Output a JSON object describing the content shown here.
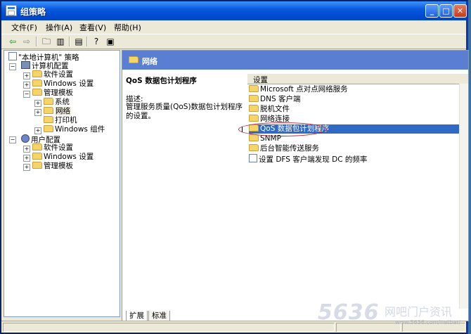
{
  "window": {
    "title": "组策略"
  },
  "menu": [
    "文件(F)",
    "操作(A)",
    "查看(V)",
    "帮助(H)"
  ],
  "tree": {
    "root": "\"本地计算机\" 策略",
    "computer": "计算机配置",
    "computer_children": [
      "软件设置",
      "Windows 设置",
      "管理模板"
    ],
    "admin_children": [
      "系统",
      "网络",
      "打印机",
      "Windows 组件"
    ],
    "user": "用户配置",
    "user_children": [
      "软件设置",
      "Windows 设置",
      "管理模板"
    ]
  },
  "right": {
    "header": "网络",
    "desc_title": "QoS 数据包计划程序",
    "desc_label": "描述:",
    "desc_text": "管理服务质量(QoS)数据包计划程序的设置。",
    "list_header": "设置",
    "items": [
      "Microsoft 点对点网络服务",
      "DNS 客户端",
      "脱机文件",
      "网络连接",
      "QoS 数据包计划程序",
      "SNMP",
      "后台智能传送服务",
      "设置 DFS 客户端发现 DC 的频率"
    ],
    "selected_index": 4
  },
  "tabs": [
    "扩展",
    "标准"
  ],
  "watermark": {
    "main": "5636",
    "side": "网吧门户资讯",
    "small": "www.5636.com/netbar/"
  }
}
